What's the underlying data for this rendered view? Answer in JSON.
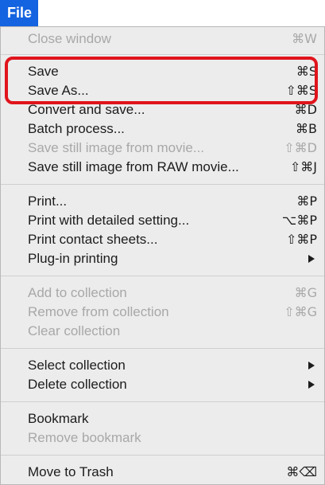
{
  "menu": {
    "title": "File",
    "items": [
      {
        "label": "Close window",
        "shortcut": "⌘W",
        "enabled": false
      },
      {
        "label": "Save",
        "shortcut": "⌘S",
        "enabled": true
      },
      {
        "label": "Save As...",
        "shortcut": "⇧⌘S",
        "enabled": true
      },
      {
        "label": "Convert and save...",
        "shortcut": "⌘D",
        "enabled": true
      },
      {
        "label": "Batch process...",
        "shortcut": "⌘B",
        "enabled": true
      },
      {
        "label": "Save still image from movie...",
        "shortcut": "⇧⌘D",
        "enabled": false
      },
      {
        "label": "Save still image from RAW movie...",
        "shortcut": "⇧⌘J",
        "enabled": true
      },
      {
        "label": "Print...",
        "shortcut": "⌘P",
        "enabled": true
      },
      {
        "label": "Print with detailed setting...",
        "shortcut": "⌥⌘P",
        "enabled": true
      },
      {
        "label": "Print contact sheets...",
        "shortcut": "⇧⌘P",
        "enabled": true
      },
      {
        "label": "Plug-in printing",
        "shortcut": "",
        "enabled": true,
        "submenu": true
      },
      {
        "label": "Add to collection",
        "shortcut": "⌘G",
        "enabled": false
      },
      {
        "label": "Remove from collection",
        "shortcut": "⇧⌘G",
        "enabled": false
      },
      {
        "label": "Clear collection",
        "shortcut": "",
        "enabled": false
      },
      {
        "label": "Select collection",
        "shortcut": "",
        "enabled": true,
        "submenu": true
      },
      {
        "label": "Delete collection",
        "shortcut": "",
        "enabled": true,
        "submenu": true
      },
      {
        "label": "Bookmark",
        "shortcut": "",
        "enabled": true
      },
      {
        "label": "Remove bookmark",
        "shortcut": "",
        "enabled": false
      },
      {
        "label": "Move to Trash",
        "shortcut": "⌘⌫",
        "enabled": true
      }
    ]
  },
  "colors": {
    "menu_title_bg": "#1463e0",
    "highlight_box": "#e0141c",
    "panel_bg": "#ececec",
    "disabled_text": "#a8a8a8"
  }
}
